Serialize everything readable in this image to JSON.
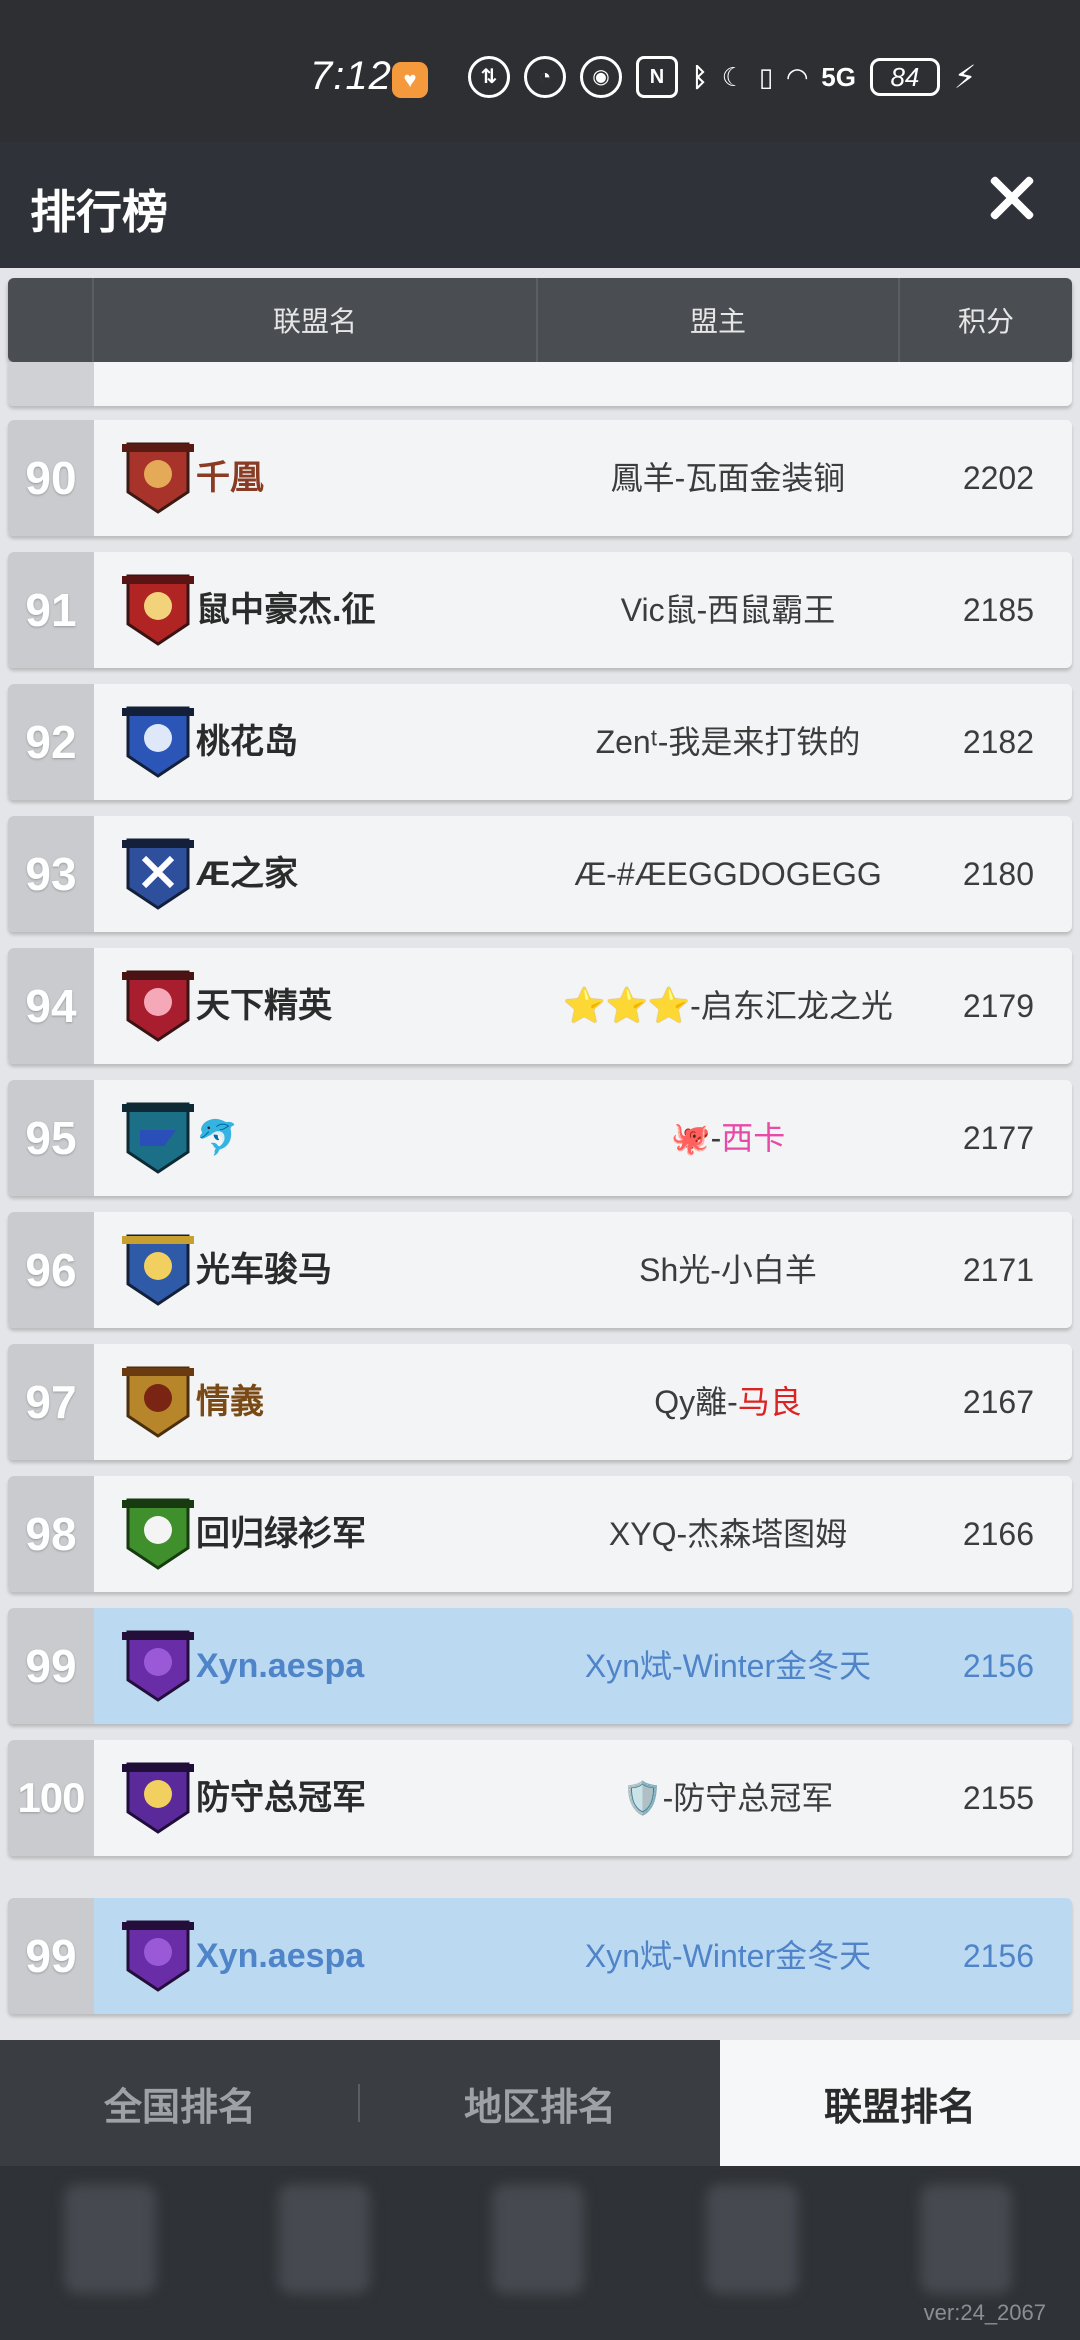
{
  "status": {
    "time": "7:12",
    "battery": "84",
    "signal": "5G"
  },
  "header": {
    "title": "排行榜"
  },
  "columns": {
    "alliance_name": "联盟名",
    "leader": "盟主",
    "score": "积分"
  },
  "rows": [
    {
      "rank": "90",
      "name": "千凰",
      "leader": "鳳羊-瓦面金装锏",
      "score": "2202",
      "emblem_color": "#a8332a"
    },
    {
      "rank": "91",
      "name": "鼠中豪杰.征",
      "leader": "Vic鼠-西鼠霸王",
      "score": "2185",
      "emblem_color": "#b02424"
    },
    {
      "rank": "92",
      "name": "桃花岛",
      "leader": "Zenᵗ-我是来打铁的",
      "score": "2182",
      "emblem_color": "#2b56b8"
    },
    {
      "rank": "93",
      "name": "Æ之家",
      "leader": "Æ-#ÆEGGDOGEGG",
      "score": "2180",
      "emblem_color": "#2d4f9c"
    },
    {
      "rank": "94",
      "name": "天下精英",
      "leader_prefix": "⭐⭐⭐",
      "leader": "-启东汇龙之光",
      "score": "2179",
      "emblem_color": "#a81e2e"
    },
    {
      "rank": "95",
      "name": "🐬",
      "leader_prefix": "🐙",
      "leader_sep": "-",
      "leader_colored": "西卡",
      "score": "2177",
      "emblem_color": "#1b6f86"
    },
    {
      "rank": "96",
      "name": "光车骏马",
      "leader": "Sh光-小白羊",
      "score": "2171",
      "emblem_color": "#2e5aa8"
    },
    {
      "rank": "97",
      "name": "情義",
      "leader": "Qy離-",
      "leader_colored": "马良",
      "score": "2167",
      "emblem_color": "#b8862a"
    },
    {
      "rank": "98",
      "name": "回归绿衫军",
      "leader": "XYQ-杰森塔图姆",
      "score": "2166",
      "emblem_color": "#3f8f2c"
    },
    {
      "rank": "99",
      "name": "Xyn.aespa",
      "leader": "Xyn烒-Winter金冬天",
      "score": "2156",
      "emblem_color": "#6a2da8"
    },
    {
      "rank": "100",
      "name": "防守总冠军",
      "leader_prefix": "🛡️",
      "leader": "-防守总冠军",
      "score": "2155",
      "emblem_color": "#5a2a9a"
    }
  ],
  "my_alliance": {
    "rank": "99",
    "name": "Xyn.aespa",
    "leader": "Xyn烒-Winter金冬天",
    "score": "2156",
    "emblem_color": "#6a2da8"
  },
  "tabs": [
    {
      "label": "全国排名",
      "active": false
    },
    {
      "label": "地区排名",
      "active": false
    },
    {
      "label": "联盟排名",
      "active": true
    }
  ],
  "version": "ver:24_2067"
}
